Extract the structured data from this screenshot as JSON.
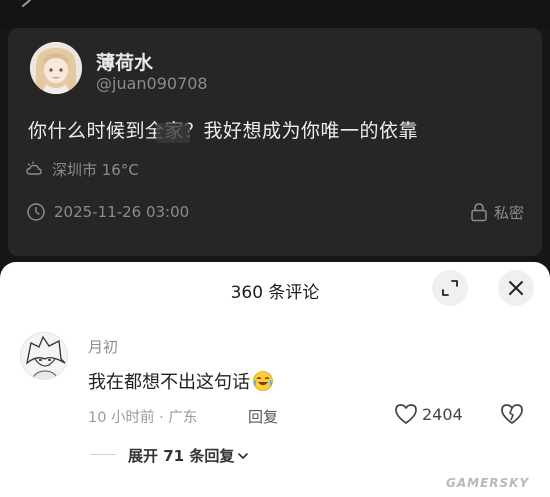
{
  "post": {
    "author_name": "薄荷水",
    "author_handle": "@juan090708",
    "text": "你什么时候到全家？我好想成为你唯一的依靠",
    "weather": "深圳市 16°C",
    "timestamp": "2025-11-26 03:00",
    "privacy_label": "私密"
  },
  "comments_sheet": {
    "title": "360 条评论",
    "comments": [
      {
        "user": "月初",
        "text": "我在都想不出这句话",
        "time_location": "10 小时前 · 广东",
        "reply_label": "回复",
        "like_count": "2404",
        "expand_replies": "展开 71 条回复"
      }
    ]
  },
  "watermark": "GAMERSKY",
  "icons": {
    "weather": "cloud-sun-icon",
    "time": "clock-icon",
    "privacy": "lock-icon",
    "expand": "expand-icon",
    "close": "close-icon",
    "like": "heart-outline-icon",
    "dislike": "broken-heart-icon",
    "chevron": "chevron-down-icon",
    "emoji": "laugh-cry-emoji"
  }
}
